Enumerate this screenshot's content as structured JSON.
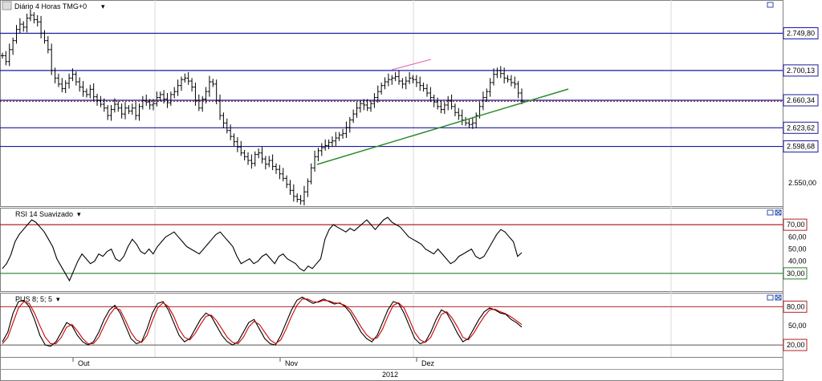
{
  "header": {
    "main_title": "Diário 4 Horas TMG+0",
    "rsi_title": "RSI 14 Suavizado",
    "stoch_title": "PUS 8; 5; 5"
  },
  "price_axis": {
    "levels": [
      {
        "value": "2.749,80",
        "price": 2749.8
      },
      {
        "value": "2.700,13",
        "price": 2700.13
      },
      {
        "value": "2.660,34",
        "price": 2660.34
      },
      {
        "value": "2.623,62",
        "price": 2623.62
      },
      {
        "value": "2.598,68",
        "price": 2598.68
      }
    ],
    "plain_tick": {
      "value": "2.550,00",
      "price": 2550
    }
  },
  "rsi_axis": {
    "boxed": [
      {
        "value": "70,00",
        "level": 70
      },
      {
        "value": "30,00",
        "level": 30
      }
    ],
    "plain": [
      {
        "value": "60,00",
        "level": 60
      },
      {
        "value": "50,00",
        "level": 50
      },
      {
        "value": "40,00",
        "level": 40
      }
    ]
  },
  "stoch_axis": {
    "boxed": [
      {
        "value": "80,00",
        "level": 80
      },
      {
        "value": "20,00",
        "level": 20
      }
    ],
    "plain": [
      {
        "value": "50,00",
        "level": 50
      }
    ]
  },
  "time_axis": {
    "months": [
      "Out",
      "Nov",
      "Dez"
    ],
    "year": "2012"
  },
  "colors": {
    "horizontal_level": "#1a1aa0",
    "close_dotted": "#8b0000",
    "trendline": "#2e8b2e",
    "rsi_upper": "#b22222",
    "rsi_lower": "#2e7d2e",
    "stoch_signal": "#cc0000",
    "bar": "#000000"
  },
  "chart_data": [
    {
      "type": "ohlc",
      "title": "Diário 4 Horas TMG+0",
      "ylim": [
        2520,
        2775
      ],
      "price_levels": [
        2749.8,
        2700.13,
        2660.34,
        2623.62,
        2598.68
      ],
      "last_close": 2659,
      "close_series": [
        2720,
        2712,
        2728,
        2740,
        2755,
        2762,
        2758,
        2770,
        2774,
        2768,
        2765,
        2750,
        2740,
        2728,
        2700,
        2690,
        2682,
        2676,
        2683,
        2690,
        2695,
        2685,
        2678,
        2672,
        2668,
        2675,
        2665,
        2660,
        2655,
        2650,
        2640,
        2648,
        2655,
        2650,
        2642,
        2650,
        2646,
        2650,
        2640,
        2652,
        2660,
        2658,
        2654,
        2656,
        2664,
        2668,
        2662,
        2657,
        2668,
        2672,
        2680,
        2688,
        2690,
        2686,
        2678,
        2660,
        2650,
        2662,
        2672,
        2685,
        2682,
        2660,
        2640,
        2630,
        2620,
        2612,
        2605,
        2598,
        2590,
        2585,
        2580,
        2576,
        2588,
        2590,
        2582,
        2575,
        2580,
        2572,
        2568,
        2562,
        2556,
        2548,
        2540,
        2532,
        2528,
        2526,
        2538,
        2552,
        2570,
        2585,
        2593,
        2597,
        2600,
        2604,
        2606,
        2610,
        2614,
        2616,
        2624,
        2634,
        2642,
        2650,
        2656,
        2654,
        2650,
        2656,
        2664,
        2672,
        2680,
        2685,
        2688,
        2690,
        2692,
        2686,
        2682,
        2686,
        2690,
        2688,
        2684,
        2680,
        2676,
        2670,
        2664,
        2658,
        2652,
        2648,
        2654,
        2660,
        2652,
        2644,
        2640,
        2634,
        2630,
        2628,
        2630,
        2640,
        2652,
        2664,
        2672,
        2684,
        2695,
        2700,
        2696,
        2690,
        2688,
        2684,
        2682,
        2670,
        2659
      ]
    },
    {
      "type": "line",
      "title": "RSI 14 Suavizado",
      "ylim": [
        20,
        78
      ],
      "reference_lines": [
        70,
        30
      ],
      "series": [
        {
          "values": [
            34,
            38,
            45,
            56,
            62,
            66,
            70,
            74,
            72,
            68,
            64,
            58,
            52,
            42,
            36,
            30,
            24,
            32,
            40,
            46,
            42,
            38,
            40,
            46,
            44,
            48,
            50,
            42,
            40,
            44,
            52,
            58,
            54,
            48,
            46,
            50,
            46,
            52,
            56,
            60,
            62,
            64,
            60,
            56,
            52,
            50,
            48,
            46,
            50,
            54,
            58,
            62,
            64,
            60,
            56,
            52,
            44,
            38,
            40,
            42,
            38,
            40,
            44,
            46,
            42,
            38,
            44,
            46,
            42,
            40,
            38,
            34,
            32,
            36,
            34,
            38,
            42,
            58,
            66,
            70,
            68,
            66,
            64,
            67,
            65,
            68,
            71,
            74,
            70,
            66,
            70,
            74,
            76,
            72,
            70,
            68,
            64,
            60,
            58,
            56,
            54,
            50,
            48,
            46,
            50,
            46,
            42,
            38,
            40,
            44,
            46,
            48,
            50,
            44,
            42,
            44,
            50,
            56,
            62,
            66,
            64,
            60,
            56,
            44,
            47
          ]
        }
      ]
    },
    {
      "type": "line",
      "title": "PUS 8; 5; 5",
      "ylim": [
        5,
        98
      ],
      "reference_lines": [
        80,
        20
      ],
      "series": [
        {
          "values": [
            25,
            40,
            70,
            88,
            90,
            80,
            60,
            35,
            20,
            18,
            25,
            40,
            55,
            50,
            35,
            25,
            20,
            25,
            40,
            60,
            75,
            82,
            70,
            50,
            30,
            22,
            25,
            45,
            70,
            85,
            88,
            75,
            55,
            35,
            25,
            30,
            45,
            60,
            70,
            65,
            50,
            35,
            25,
            20,
            25,
            40,
            55,
            60,
            45,
            30,
            22,
            20,
            35,
            55,
            75,
            90,
            95,
            90,
            85,
            88,
            92,
            88,
            84,
            86,
            80,
            70,
            55,
            40,
            30,
            25,
            35,
            55,
            75,
            88,
            85,
            70,
            50,
            30,
            22,
            25,
            40,
            60,
            75,
            70,
            55,
            38,
            25,
            30,
            45,
            60,
            72,
            78,
            75,
            70,
            68,
            60,
            55,
            48
          ]
        },
        {
          "values": [
            22,
            32,
            55,
            78,
            88,
            85,
            70,
            50,
            32,
            22,
            22,
            32,
            48,
            52,
            42,
            30,
            22,
            22,
            32,
            50,
            67,
            78,
            75,
            58,
            40,
            28,
            24,
            35,
            58,
            78,
            86,
            80,
            65,
            45,
            32,
            28,
            38,
            52,
            65,
            67,
            58,
            45,
            32,
            24,
            22,
            32,
            48,
            57,
            52,
            40,
            28,
            22,
            28,
            45,
            65,
            82,
            92,
            92,
            88,
            87,
            90,
            89,
            86,
            85,
            82,
            75,
            62,
            48,
            36,
            29,
            31,
            45,
            65,
            82,
            86,
            78,
            60,
            40,
            28,
            24,
            32,
            50,
            68,
            72,
            62,
            48,
            32,
            28,
            38,
            52,
            65,
            75,
            76,
            72,
            69,
            64,
            58,
            52
          ]
        }
      ]
    }
  ]
}
